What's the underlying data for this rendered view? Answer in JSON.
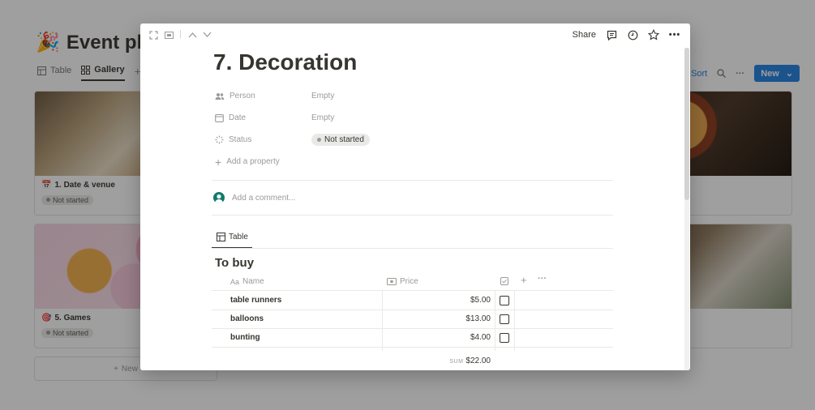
{
  "background": {
    "page_title": "Event pla",
    "page_emoji": "🎉",
    "views": [
      {
        "label": "Table",
        "active": false
      },
      {
        "label": "Gallery",
        "active": true
      }
    ],
    "toolbar": {
      "sort": "Sort",
      "new": "New"
    },
    "cards": [
      {
        "title": "1. Date & venue",
        "emoji": "📅",
        "status": "Not started"
      },
      {
        "title": "5. Games",
        "emoji": "🎯",
        "status": "Not started"
      }
    ],
    "new_label": "New"
  },
  "modal": {
    "toolbar": {
      "share": "Share"
    },
    "title": "7. Decoration",
    "properties": [
      {
        "label": "Person",
        "value": "Empty",
        "icon": "people-icon"
      },
      {
        "label": "Date",
        "value": "Empty",
        "icon": "calendar-icon"
      },
      {
        "label": "Status",
        "value": "Not started",
        "icon": "status-icon"
      }
    ],
    "add_property": "Add a property",
    "comment_placeholder": "Add a comment...",
    "db_tab": "Table",
    "db_title": "To buy",
    "columns": {
      "name": "Name",
      "price": "Price"
    },
    "rows": [
      {
        "name": "table runners",
        "price": "$5.00",
        "checked": false
      },
      {
        "name": "balloons",
        "price": "$13.00",
        "checked": false
      },
      {
        "name": "bunting",
        "price": "$4.00",
        "checked": false
      }
    ],
    "sum_label": "SUM",
    "sum_value": "$22.00"
  }
}
